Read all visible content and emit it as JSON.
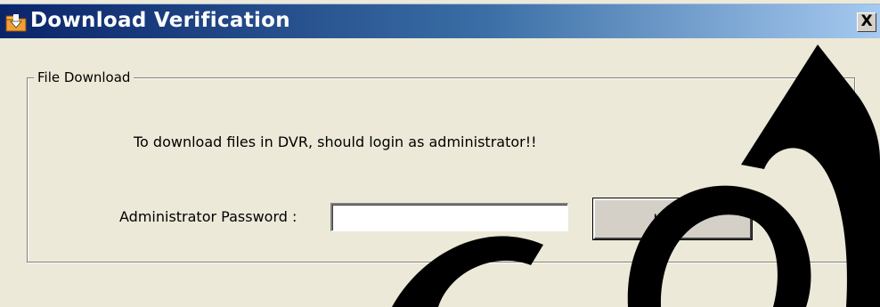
{
  "window": {
    "title": "Download Verification",
    "close_label": "X",
    "icon": "download-folder-icon"
  },
  "group": {
    "legend": "File Download",
    "message": "To download files in DVR, should login as administrator!!"
  },
  "form": {
    "password_label": "Administrator Password :",
    "password_value": "",
    "login_label": "Login"
  },
  "colors": {
    "titlebar_start": "#0a246a",
    "titlebar_end": "#a6caf0",
    "dialog_background": "#ece9d8",
    "watermark": "#000000"
  }
}
